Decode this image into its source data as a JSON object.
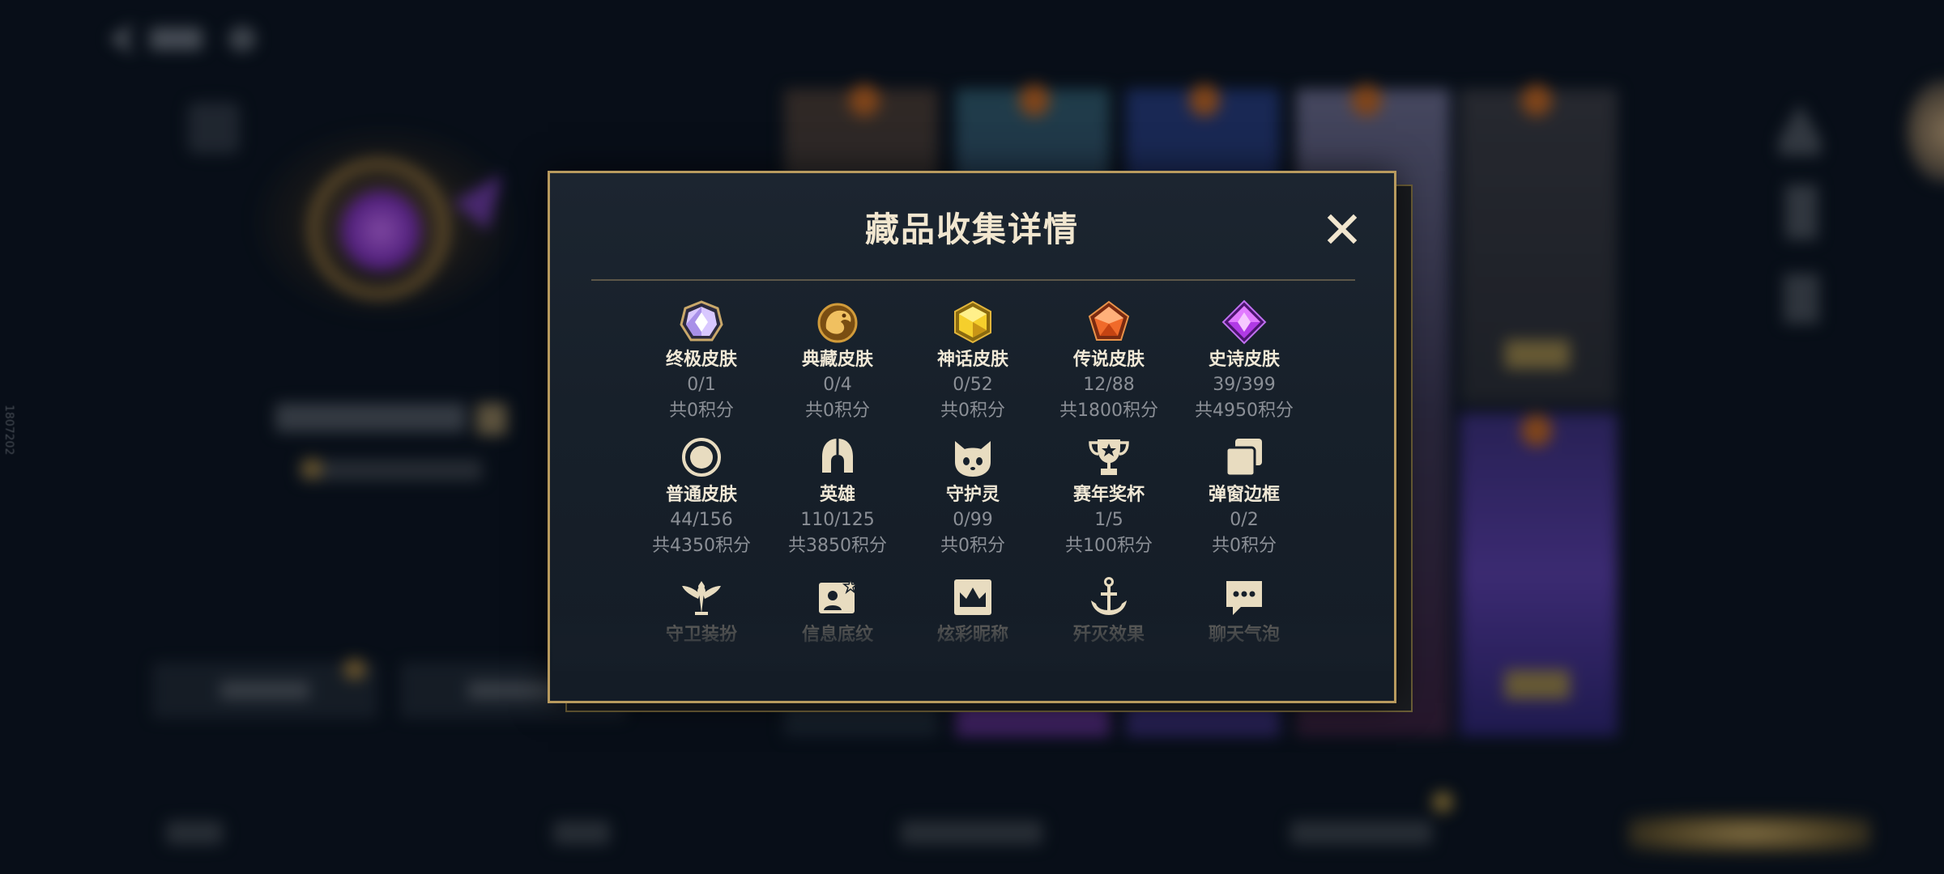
{
  "dialog": {
    "title": "藏品收集详情",
    "close_icon": "close-icon"
  },
  "colors": {
    "gold_border": "#b89a5e",
    "panel_bg": "#17202a",
    "label_text": "#f0e8d6",
    "stat_text": "#8b8f96",
    "page_bg": "#0b121c"
  },
  "items": [
    {
      "label": "终极皮肤",
      "count": "0/1",
      "points": "共0积分",
      "icon": "ultimate-skin-gem-icon"
    },
    {
      "label": "典藏皮肤",
      "count": "0/4",
      "points": "共0积分",
      "icon": "collector-skin-dragon-icon"
    },
    {
      "label": "神话皮肤",
      "count": "0/52",
      "points": "共0积分",
      "icon": "mythic-skin-gem-icon"
    },
    {
      "label": "传说皮肤",
      "count": "12/88",
      "points": "共1800积分",
      "icon": "legend-skin-gem-icon"
    },
    {
      "label": "史诗皮肤",
      "count": "39/399",
      "points": "共4950积分",
      "icon": "epic-skin-gem-icon"
    },
    {
      "label": "普通皮肤",
      "count": "44/156",
      "points": "共4350积分",
      "icon": "normal-skin-ring-icon"
    },
    {
      "label": "英雄",
      "count": "110/125",
      "points": "共3850积分",
      "icon": "hero-helmet-icon"
    },
    {
      "label": "守护灵",
      "count": "0/99",
      "points": "共0积分",
      "icon": "guardian-spirit-icon"
    },
    {
      "label": "赛年奖杯",
      "count": "1/5",
      "points": "共100积分",
      "icon": "season-trophy-icon"
    },
    {
      "label": "弹窗边框",
      "count": "0/2",
      "points": "共0积分",
      "icon": "popup-frame-icon"
    },
    {
      "label": "守卫装扮",
      "icon": "ward-outfit-icon"
    },
    {
      "label": "信息底纹",
      "icon": "info-background-icon"
    },
    {
      "label": "炫彩昵称",
      "icon": "colorful-nickname-icon"
    },
    {
      "label": "歼灭效果",
      "icon": "elimination-effect-icon"
    },
    {
      "label": "聊天气泡",
      "icon": "chat-bubble-icon"
    }
  ],
  "background": {
    "side_text": "1807202"
  }
}
